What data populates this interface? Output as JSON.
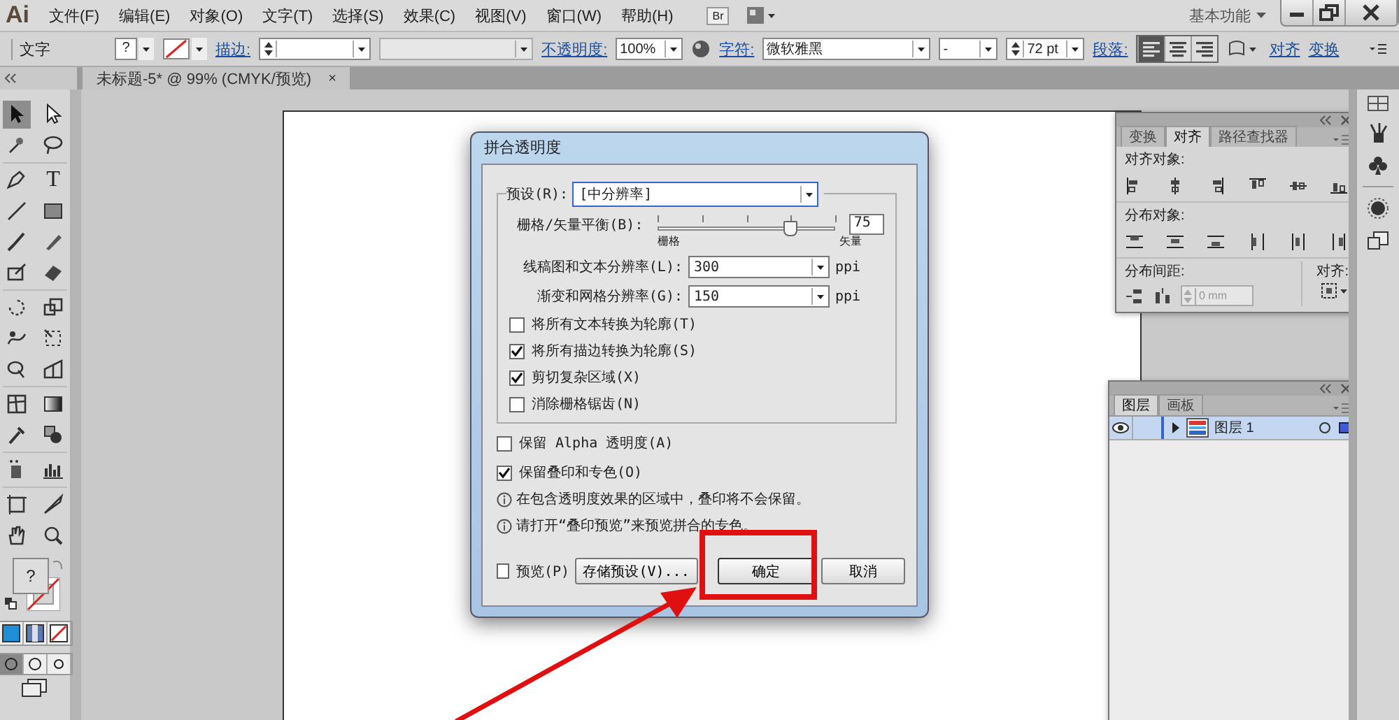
{
  "app": {
    "logo": "Ai",
    "menus": [
      "文件(F)",
      "编辑(E)",
      "对象(O)",
      "文字(T)",
      "选择(S)",
      "效果(C)",
      "视图(V)",
      "窗口(W)",
      "帮助(H)"
    ],
    "bridge": "Br",
    "workspace": "基本功能"
  },
  "control_bar": {
    "label": "文字",
    "fill": "?",
    "stroke_label": "描边:",
    "opacity_label": "不透明度:",
    "opacity": "100%",
    "char_label": "字符:",
    "font": "微软雅黑",
    "style": "-",
    "size": "72 pt",
    "para_label": "段落:",
    "para_align": [
      {
        "selected": true
      },
      {
        "selected": false
      },
      {
        "selected": false
      }
    ],
    "align_link": "对齐",
    "transform_link": "变换"
  },
  "document_tab": {
    "title": "未标题-5* @ 99% (CMYK/预览)",
    "close": "×"
  },
  "toolbar": {
    "type_glyph": "T",
    "fill_glyph": "?"
  },
  "dialog": {
    "title": "拼合透明度",
    "preset_label": "预设(R):",
    "preset": "[中分辨率]",
    "balance_label": "栅格/矢量平衡(B):",
    "balance": {
      "level": 0.75
    },
    "balance_value": "75",
    "min_label": "栅格",
    "max_label": "矢量",
    "raster_label": "线稿图和文本分辨率(L):",
    "raster": "300",
    "raster_unit": "ppi",
    "gradient_label": "渐变和网格分辨率(G):",
    "gradient": "150",
    "gradient_unit": "ppi",
    "options": [
      {
        "label": "将所有文本转换为轮廓(T)",
        "checked": false
      },
      {
        "label": "将所有描边转换为轮廓(S)",
        "checked": true
      },
      {
        "label": "剪切复杂区域(X)",
        "checked": true
      },
      {
        "label": "消除栅格锯齿(N)",
        "checked": false
      }
    ],
    "outer_options": [
      {
        "label": "保留 Alpha 透明度(A)",
        "checked": false
      },
      {
        "label": "保留叠印和专色(O)",
        "checked": true
      }
    ],
    "notes": [
      "在包含透明度效果的区域中，叠印将不会保留。",
      "请打开“叠印预览”来预览拼合的专色。"
    ],
    "preview": {
      "label": "预览(P)",
      "checked": false
    },
    "buttons": [
      "存储预设(V)...",
      "确定",
      "取消"
    ]
  },
  "align_panel": {
    "tabs": [
      {
        "label": "变换",
        "selected": false
      },
      {
        "label": "对齐",
        "selected": true
      },
      {
        "label": "路径查找器",
        "selected": false
      }
    ],
    "align_objects": "对齐对象:",
    "distribute_objects": "分布对象:",
    "distribute_spacing": "分布间距:",
    "spacing_value": "0 mm",
    "align_to": "对齐:"
  },
  "layers_panel": {
    "tabs": [
      {
        "label": "图层",
        "selected": true
      },
      {
        "label": "画板",
        "selected": false
      }
    ],
    "layers": [
      {
        "name": "图层 1",
        "visible": true,
        "selected": true
      }
    ]
  }
}
